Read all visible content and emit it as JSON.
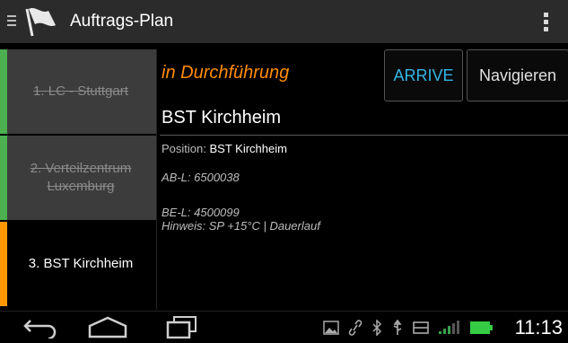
{
  "app": {
    "title": "Auftrags-Plan"
  },
  "stops": [
    {
      "label": "1. LC - Stuttgart",
      "state": "done",
      "bar_color": "#4caf50"
    },
    {
      "label": "2. Verteilzentrum Luxemburg",
      "state": "done",
      "bar_color": "#4caf50"
    },
    {
      "label": "3. BST Kirchheim",
      "state": "active",
      "bar_color": "#ff9800"
    }
  ],
  "detail": {
    "status": "in Durchführung",
    "arrive_label": "ARRIVE",
    "navigate_label": "Navigieren",
    "destination": "BST Kirchheim",
    "position_label": "Position:",
    "position_value": "BST Kirchheim",
    "ab_l": "AB-L: 6500038",
    "be_l": "BE-L: 4500099",
    "hinweis": "Hinweis: SP +15°C | Dauerlauf"
  },
  "statusbar": {
    "time": "11:13"
  },
  "colors": {
    "accent_orange": "#ff8c00",
    "accent_blue": "#33b5e5",
    "done_green": "#4caf50"
  }
}
